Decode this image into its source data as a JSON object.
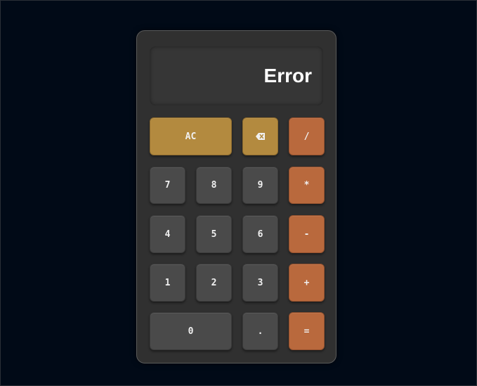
{
  "display": {
    "value": "Error"
  },
  "keys": {
    "clear": "AC",
    "divide": "/",
    "multiply": "*",
    "subtract": "-",
    "add": "+",
    "equals": "=",
    "decimal": ".",
    "digit_0": "0",
    "digit_1": "1",
    "digit_2": "2",
    "digit_3": "3",
    "digit_4": "4",
    "digit_5": "5",
    "digit_6": "6",
    "digit_7": "7",
    "digit_8": "8",
    "digit_9": "9",
    "backspace_icon": "backspace-icon"
  },
  "colors": {
    "background": "#010a17",
    "body": "#303030",
    "number_key": "#4a4a4a",
    "utility_key": "#b38a3f",
    "operator_key": "#b9693d"
  }
}
